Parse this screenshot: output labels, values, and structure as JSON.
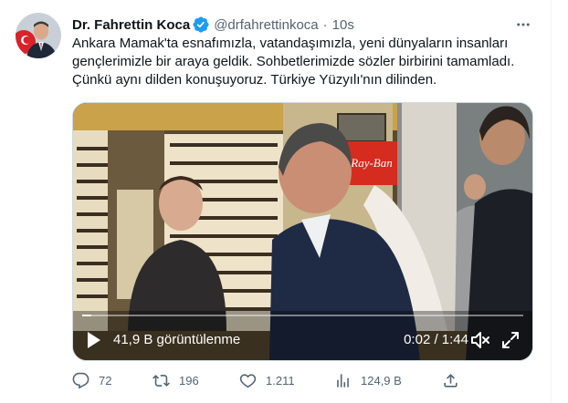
{
  "tweet": {
    "author_name": "Dr. Fahrettin Koca",
    "handle": "@drfahrettinkoca",
    "separator": "·",
    "time": "10s",
    "text": "Ankara Mamak'ta esnafımızla, vatandaşımızla, yeni dünyaların insanları gençlerimizle bir araya geldik. Sohbetlerimizde sözler birbirini tamamladı. Çünkü aynı dilden konuşuyoruz. Türkiye Yüzyılı'nın dilinden."
  },
  "video": {
    "views": "41,9 B görüntülenme",
    "time_display": "0:02 / 1:44",
    "progress_fraction": 0.02,
    "store_sign": "Ray-Ban"
  },
  "actions": {
    "replies": "72",
    "retweets": "196",
    "likes": "1.211",
    "views": "124,9 B"
  },
  "colors": {
    "verified": "#1d9bf0",
    "secondary_text": "#536471",
    "primary_text": "#0f1419"
  }
}
